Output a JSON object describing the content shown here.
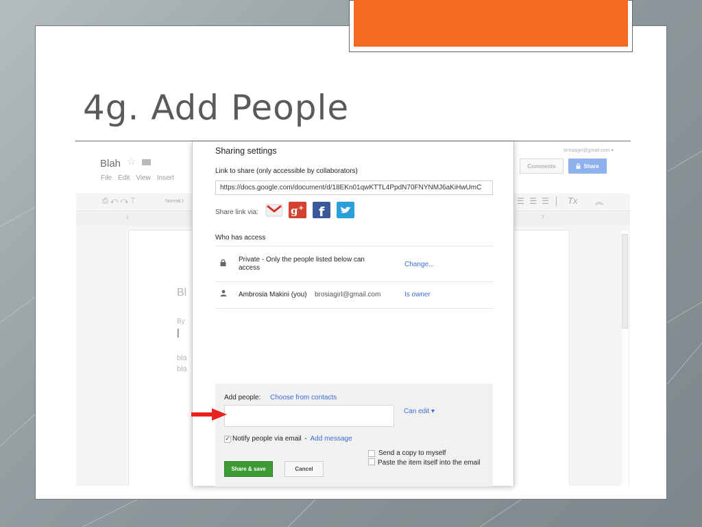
{
  "slide": {
    "title": "4g. Add People",
    "accent_color": "#f26b21"
  },
  "docs": {
    "doc_title": "Blah",
    "menu": [
      "File",
      "Edit",
      "View",
      "Insert"
    ],
    "account_email": "brosiagirl@gmail.com",
    "dropdown_caret": "▾",
    "comments_label": "Comments",
    "share_label": "Share",
    "toolbar_style": "Normal t",
    "ruler_left": "1",
    "ruler_right": "7",
    "page_heading": "Bl",
    "page_byline": "By",
    "page_body_line1": "bla",
    "page_body_line2": "bla",
    "formatting_icon": "Tx"
  },
  "dialog": {
    "title": "Sharing settings",
    "link_label": "Link to share (only accessible by collaborators)",
    "link_value": "https://docs.google.com/document/d/18EKn01qwKTTL4PpdN70FNYNMJ6aKiHwUmC",
    "share_via_label": "Share link via:",
    "social_icons": [
      "gmail-icon",
      "google-plus-icon",
      "facebook-icon",
      "twitter-icon"
    ],
    "who_has_access_label": "Who has access",
    "access_rows": [
      {
        "icon": "lock-icon",
        "text": "Private - Only the people listed below can access",
        "action": "Change..."
      },
      {
        "name": "Ambrosia Makini (you)",
        "email": "brosiagirl@gmail.com",
        "action": "Is owner"
      }
    ],
    "add_people": {
      "label": "Add people:",
      "contacts_link": "Choose from contacts",
      "input_value": "",
      "permission": "Can edit",
      "permission_caret": "▾",
      "notify_checked": true,
      "notify_label": "Notify people via email",
      "notify_separator": " - ",
      "add_message_link": "Add message",
      "send_copy_label": "Send a copy to myself",
      "paste_item_label": "Paste the item itself into the email",
      "share_save_label": "Share & save",
      "cancel_label": "Cancel"
    },
    "link_color": "#3a6cd6",
    "primary_button_color": "#3c9b35"
  },
  "annotation": {
    "arrow_color": "#e8231f"
  }
}
